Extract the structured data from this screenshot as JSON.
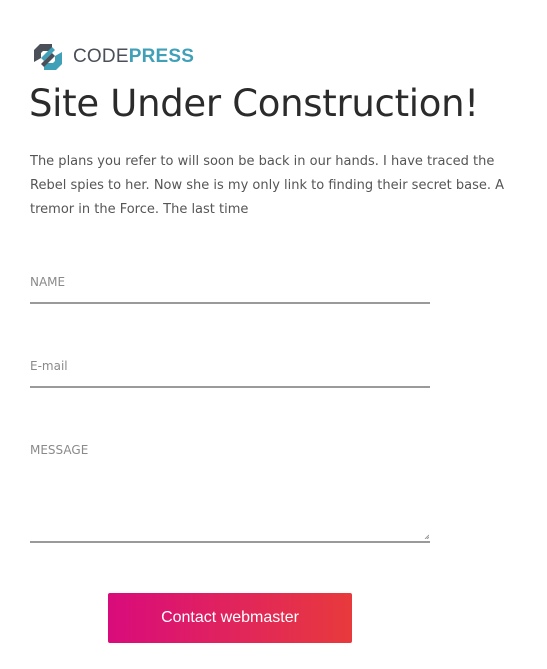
{
  "brand": {
    "name_part1": "CODE",
    "name_part2": "PRESS",
    "icon": "codepress-logo-icon",
    "colors": {
      "accent": "#3fa0b8",
      "dark": "#4a4f58"
    }
  },
  "page": {
    "title": "Site Under Construction!",
    "intro": "The plans you refer to will soon be back in our hands. I have traced the Rebel spies to her. Now she is my only link to finding their secret base. A tremor in the Force. The last time"
  },
  "form": {
    "name_placeholder": "NAME",
    "email_placeholder": "E-mail",
    "message_placeholder": "MESSAGE",
    "submit_label": "Contact webmaster",
    "button_gradient": [
      "#d90b7c",
      "#e83a3c"
    ]
  }
}
